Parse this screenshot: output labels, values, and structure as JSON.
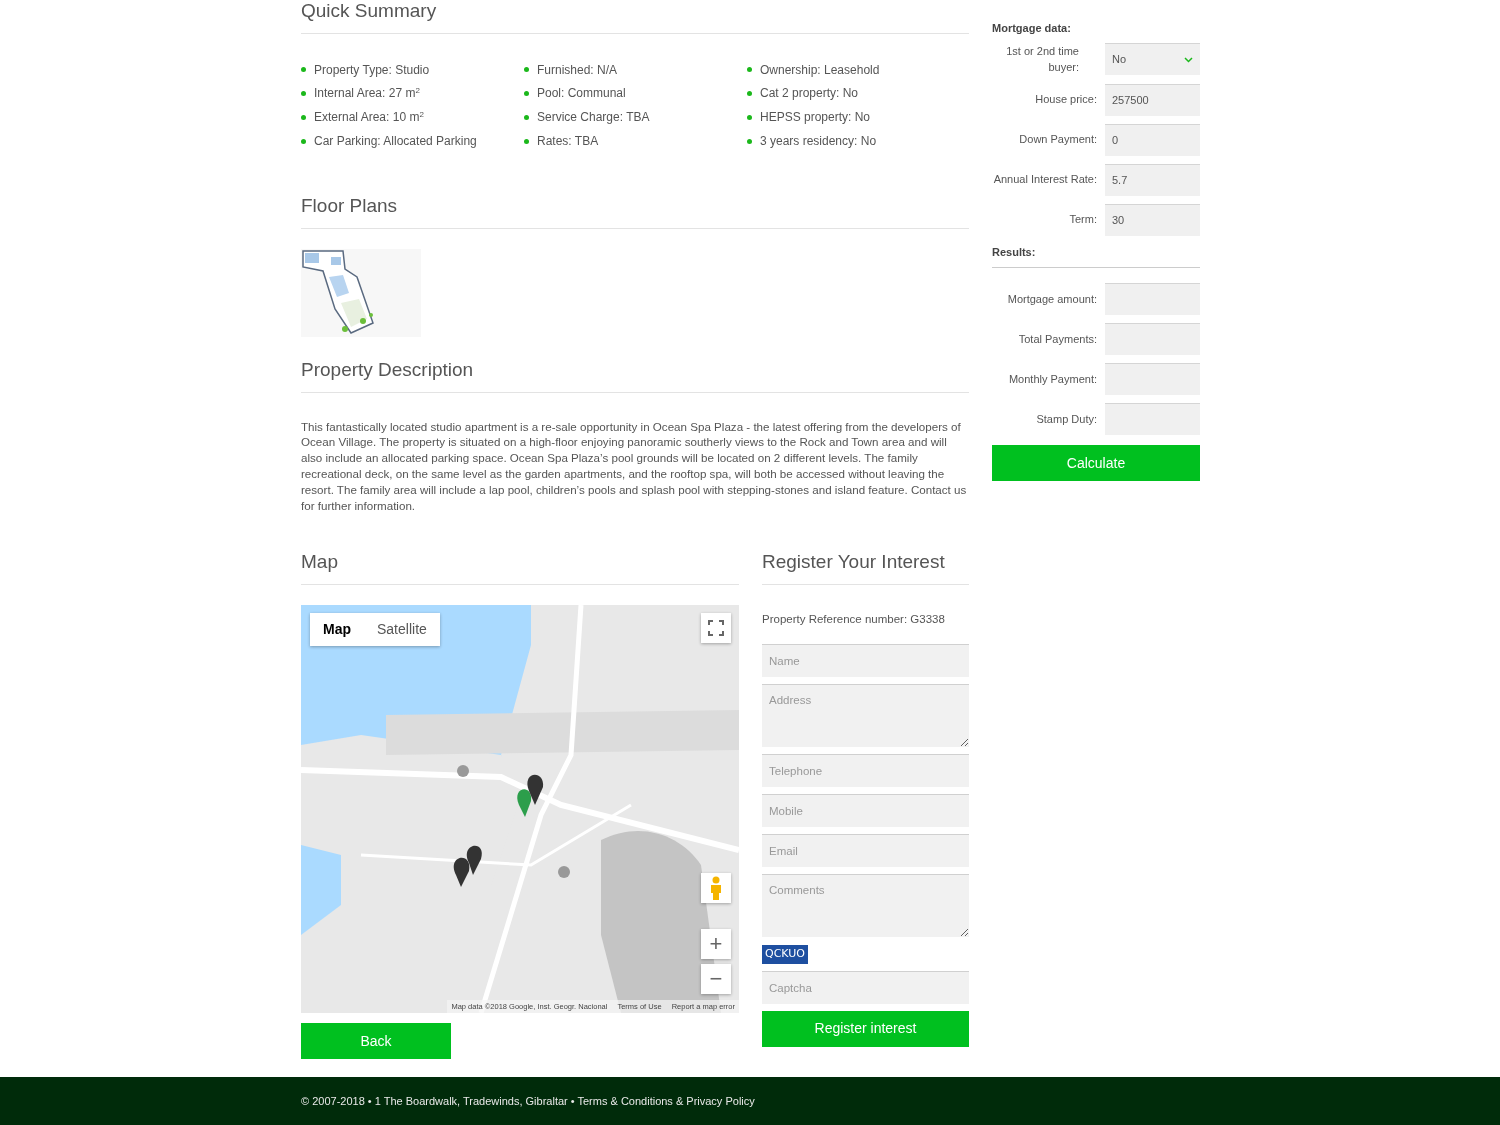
{
  "quick_summary": {
    "title": "Quick Summary",
    "columns": [
      [
        "Property Type: Studio",
        "Internal Area: 27 m$^{2}$",
        "External Area: 10 m$^{2}$",
        "Car Parking: Allocated Parking"
      ],
      [
        "Furnished: N/A",
        "Pool: Communal",
        "Service Charge: TBA",
        "Rates: TBA"
      ],
      [
        "Ownership: Leasehold",
        "Cat 2 property: No",
        "HEPSS property: No",
        "3 years residency: No"
      ]
    ]
  },
  "floor_plans": {
    "title": "Floor Plans"
  },
  "description": {
    "title": "Property Description",
    "text": "This fantastically located studio apartment is a re-sale opportunity in Ocean Spa Plaza - the latest offering from the developers of Ocean Village. The property is situated on a high-floor enjoying panoramic southerly views to the Rock and Town area and will also include an allocated parking space. Ocean Spa Plaza’s pool grounds will be located on 2 different levels. The family recreational deck, on the same level as the garden apartments, and the rooftop spa, will both be accessed without leaving the resort. The family area will include a lap pool, children’s pools and splash pool with stepping-stones and island feature. Contact us for further information."
  },
  "map": {
    "title": "Map",
    "map_types": [
      {
        "label": "Map",
        "selected": true
      },
      {
        "label": "Satellite",
        "selected": false
      }
    ],
    "zoom_in": "+",
    "zoom_out": "−",
    "attribution": [
      "Map data ©2018 Google, Inst. Geogr. Nacional",
      "Terms of Use",
      "Report a map error"
    ]
  },
  "back_button": "Back",
  "register": {
    "title": "Register Your Interest",
    "reference": "Property Reference number: G3338",
    "fields": [
      {
        "kind": "input",
        "placeholder": "Name"
      },
      {
        "kind": "textarea",
        "placeholder": "Address"
      },
      {
        "kind": "input",
        "placeholder": "Telephone"
      },
      {
        "kind": "input",
        "placeholder": "Mobile"
      },
      {
        "kind": "input",
        "placeholder": "Email"
      },
      {
        "kind": "textarea",
        "placeholder": "Comments"
      },
      {
        "kind": "captcha_image",
        "text": "QCKUO"
      },
      {
        "kind": "input",
        "placeholder": "Captcha"
      }
    ],
    "button": "Register interest"
  },
  "mortgage": {
    "title": "Mortgage data:",
    "fields": [
      {
        "kind": "select",
        "label": "1st or 2nd time buyer:",
        "value": "No"
      },
      {
        "kind": "input",
        "label": "House price:",
        "value": "257500"
      },
      {
        "kind": "input",
        "label": "Down Payment:",
        "value": "0"
      },
      {
        "kind": "input",
        "label": "Annual Interest Rate:",
        "value": "5.7"
      },
      {
        "kind": "input",
        "label": "Term:",
        "value": "30"
      }
    ],
    "results_title": "Results:",
    "results": [
      {
        "label": "Mortgage amount:"
      },
      {
        "label": "Total Payments:"
      },
      {
        "label": "Monthly Payment:"
      },
      {
        "label": "Stamp Duty:"
      }
    ],
    "button": "Calculate"
  },
  "footer": "© 2007-2018 • 1 The Boardwalk, Tradewinds, Gibraltar • Terms & Conditions & Privacy Policy"
}
